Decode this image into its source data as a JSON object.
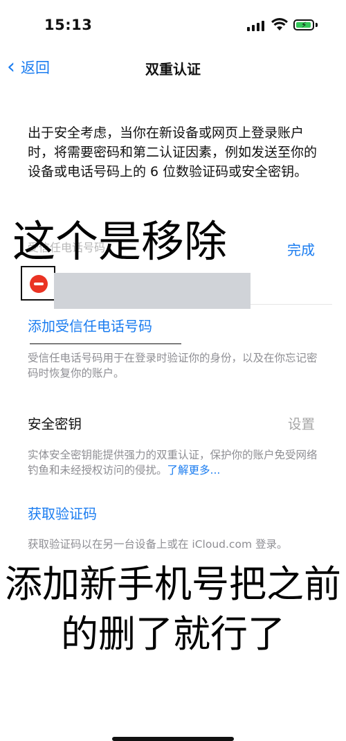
{
  "status_bar": {
    "time": "15:13",
    "battery_color": "#34c759",
    "battery_level": 0.8
  },
  "nav": {
    "back_label": "返回",
    "title": "双重认证"
  },
  "intro": "出于安全考虑，当你在新设备或网页上登录账户时，将需要密码和第二认证因素，例如发送至你的设备或电话号码上的 6 位数验证码或安全密钥。",
  "annotations": {
    "remove_note": "这个是移除",
    "bottom_note": "添加新手机号把之前的删了就行了"
  },
  "trusted_numbers": {
    "section_label": "受信任电话号码",
    "done_label": "完成",
    "add_label": "添加受信任电话号码",
    "description": "受信任电话号码用于在登录时验证你的身份，以及在你忘记密码时恢复你的账户。"
  },
  "security_key": {
    "label": "安全密钥",
    "action": "设置",
    "description": "实体安全密钥能提供强力的双重认证，保护你的账户免受网络钓鱼和未经授权访问的侵扰。",
    "learn_more": "了解更多..."
  },
  "verification": {
    "label": "获取验证码",
    "description": "获取验证码以在另一台设备上或在 iCloud.com 登录。"
  },
  "colors": {
    "accent": "#1a7cf0",
    "delete": "#ea3323"
  }
}
